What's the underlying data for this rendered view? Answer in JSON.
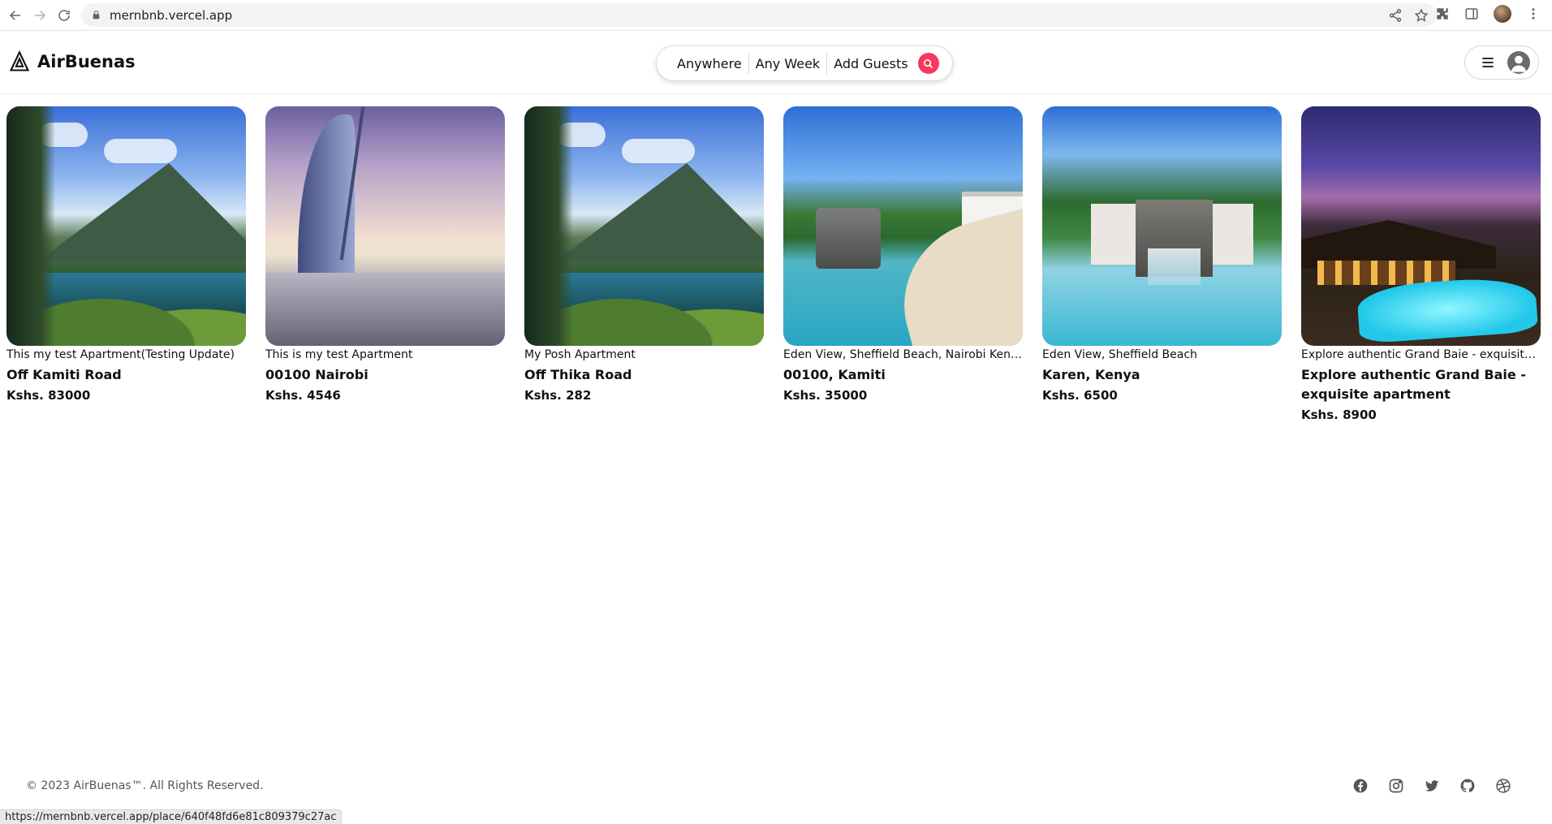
{
  "browser": {
    "url": "mernbnb.vercel.app",
    "status_url": "https://mernbnb.vercel.app/place/640f48fd6e81c809379c27ac"
  },
  "header": {
    "brand": "AirBuenas",
    "search": {
      "where": "Anywhere",
      "when": "Any Week",
      "guests": "Add Guests"
    },
    "accent_color": "#f5385d"
  },
  "listings": [
    {
      "subtitle": "This my test Apartment(Testing Update)",
      "title": "Off Kamiti Road",
      "price": "Kshs. 83000",
      "scene": "mountain-lake"
    },
    {
      "subtitle": "This is my test Apartment",
      "title": "00100 Nairobi",
      "price": "Kshs. 4546",
      "scene": "burj-sunset"
    },
    {
      "subtitle": "My Posh Apartment",
      "title": "Off Thika Road",
      "price": "Kshs. 282",
      "scene": "mountain-lake"
    },
    {
      "subtitle": "Eden View, Sheffield Beach, Nairobi Kenya",
      "title": "00100, Kamiti",
      "price": "Kshs. 35000",
      "scene": "resort-pool"
    },
    {
      "subtitle": "Eden View, Sheffield Beach",
      "title": "Karen, Kenya",
      "price": "Kshs. 6500",
      "scene": "waterfall-pool"
    },
    {
      "subtitle": "Explore authentic Grand Baie - exquisite apa…",
      "title": "Explore authentic Grand Baie - exquisite apartment",
      "price": "Kshs. 8900",
      "scene": "night-pool"
    }
  ],
  "footer": {
    "copyright": "© 2023 AirBuenas™. All Rights Reserved.",
    "social_icons": [
      "facebook-icon",
      "instagram-icon",
      "twitter-icon",
      "github-icon",
      "dribbble-icon"
    ]
  }
}
